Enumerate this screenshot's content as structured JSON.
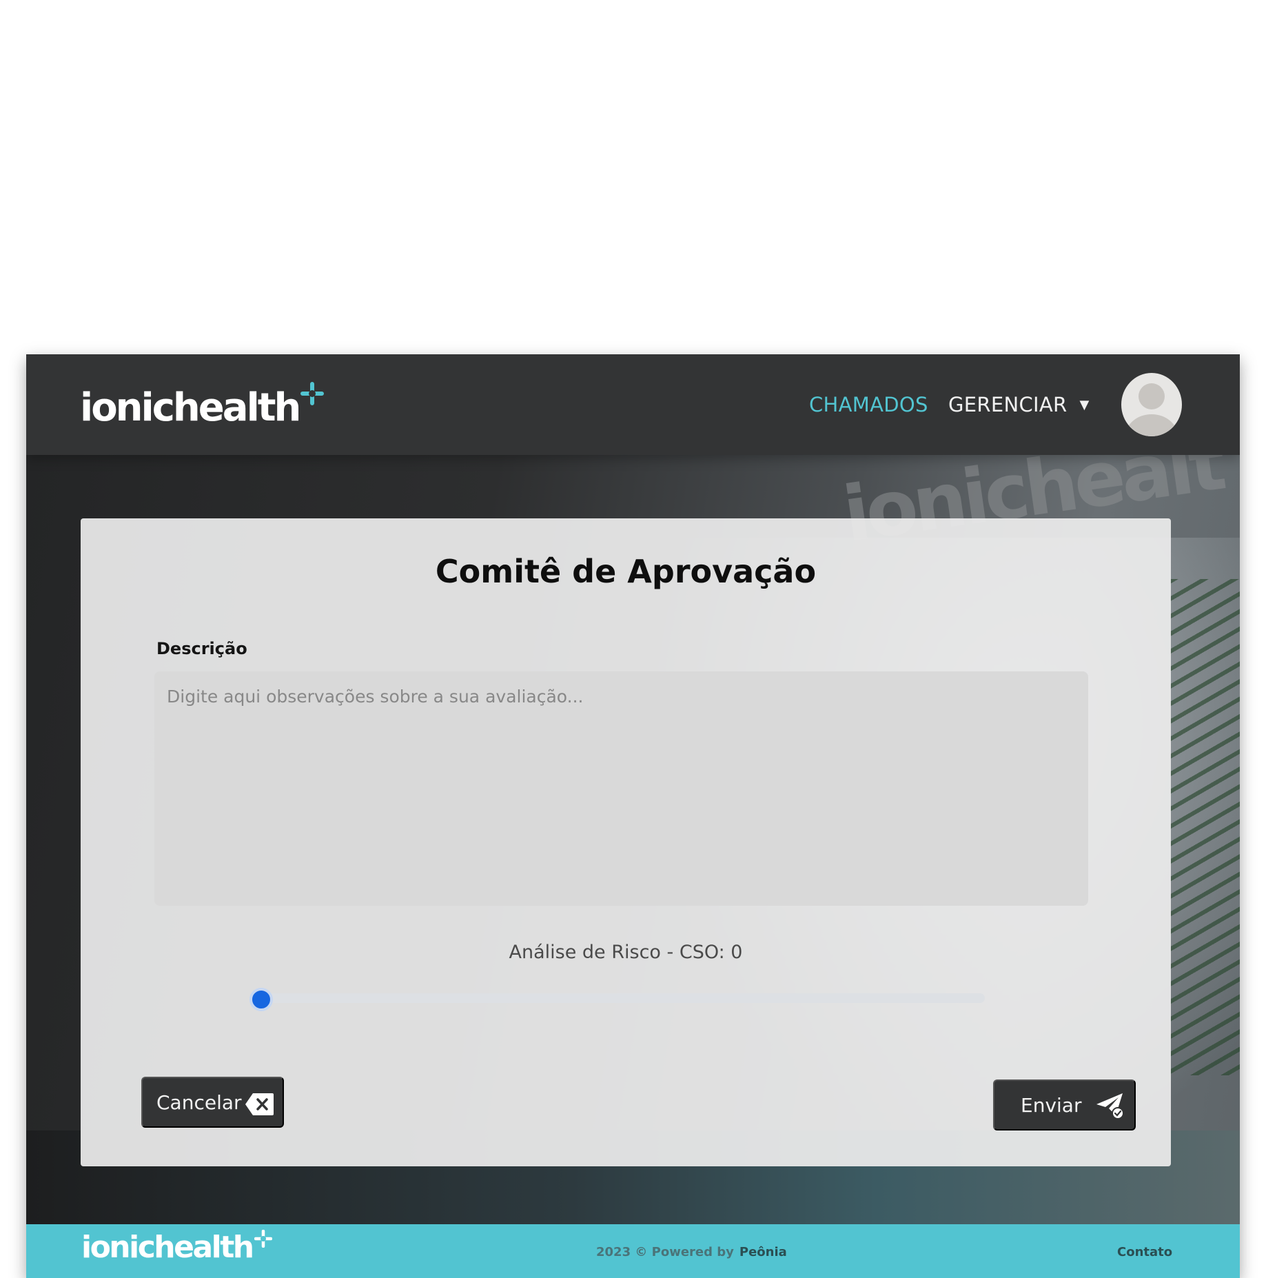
{
  "header": {
    "brand": "ionichealth",
    "nav": {
      "chamados": "CHAMADOS",
      "gerenciar": "GERENCIAR",
      "gerenciar_caret": "▼"
    },
    "accent_color": "#52c4d1"
  },
  "background": {
    "wall_text": "ionichealt"
  },
  "form": {
    "title": "Comitê de Aprovação",
    "description_label": "Descrição",
    "description_value": "",
    "description_placeholder": "Digite aqui observações sobre a sua avaliação...",
    "risk_label": "Análise de Risco - CSO: 0",
    "risk_value": 0,
    "risk_color": "#1666e0",
    "cancel_label": "Cancelar",
    "send_label": "Enviar"
  },
  "footer": {
    "brand": "ionichealth",
    "copyright": "2023 © Powered by",
    "powered_by": "Peônia",
    "contact": "Contato"
  },
  "icons": {
    "brand_plus": "plus-cross-icon",
    "avatar": "user-avatar-icon",
    "cancel": "backspace-x-icon",
    "send": "paper-plane-check-icon"
  }
}
